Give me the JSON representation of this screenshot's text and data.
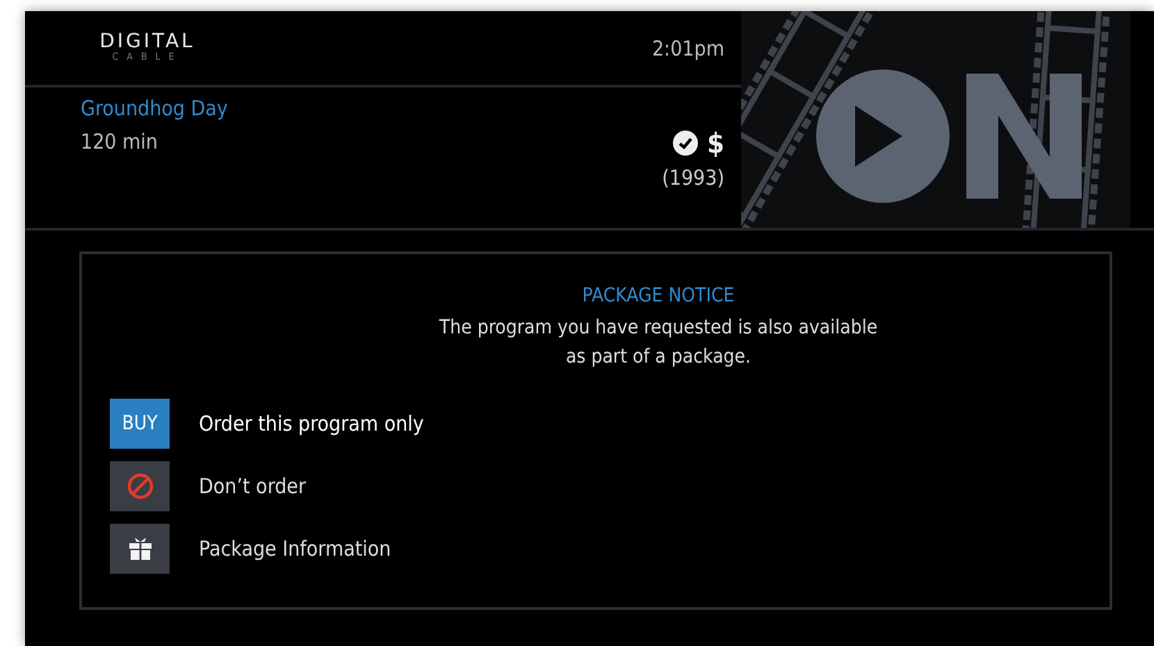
{
  "header": {
    "logo": {
      "top": "DIGITAL",
      "bottom": "CABLE"
    },
    "time": "2:01pm"
  },
  "program": {
    "title": "Groundhog Day",
    "duration": "120 min",
    "purchased": true,
    "price_mark": "$",
    "year": "(1993)"
  },
  "notice": {
    "title": "PACKAGE NOTICE",
    "message": "The program you have requested is also available as part of a package.",
    "options": [
      {
        "kind": "text",
        "badge": "BUY",
        "label": "Order this program only",
        "selected": true
      },
      {
        "kind": "cancel",
        "label": "Don’t order",
        "selected": false
      },
      {
        "kind": "gift",
        "label": "Package Information",
        "selected": false
      }
    ]
  }
}
